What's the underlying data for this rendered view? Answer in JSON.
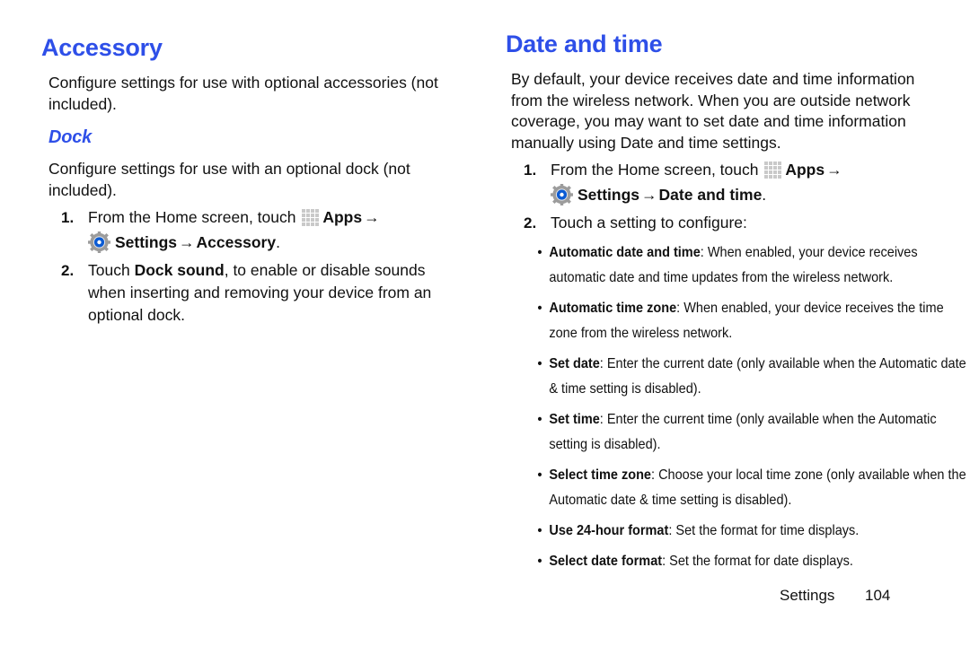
{
  "document": {
    "footer": {
      "section_label": "Settings",
      "page_number": "104"
    },
    "accent_color": "#2E4FE8",
    "text_color": "#111111"
  },
  "left_column": {
    "title": "Accessory",
    "intro": "Configure settings for use with optional accessories (not included).",
    "subsection": {
      "title": "Dock",
      "intro": "Configure settings for use with an optional dock (not included).",
      "steps": [
        {
          "number": "1.",
          "line1_prefix": "From the Home screen, touch ",
          "apps_label": "Apps",
          "arrow": "→",
          "settings_label": "Settings",
          "arrow2": "→",
          "destination_label": "Accessory",
          "period": "."
        },
        {
          "number": "2.",
          "text_prefix": "Touch ",
          "bold_term": "Dock sound",
          "text_suffix": ", to enable or disable sounds when inserting and removing your device from an optional dock."
        }
      ]
    }
  },
  "right_column": {
    "title": "Date and time",
    "intro": "By default, your device receives date and time information from the wireless network. When you are outside network coverage, you may want to set date and time information manually using Date and time settings.",
    "steps": [
      {
        "number": "1.",
        "line1_prefix": "From the Home screen, touch ",
        "apps_label": "Apps",
        "arrow": "→",
        "settings_label": "Settings",
        "arrow2": "→",
        "destination_label": "Date and time",
        "period": "."
      },
      {
        "number": "2.",
        "text": "Touch a setting to configure:"
      }
    ],
    "bullets": [
      {
        "bullet": "•",
        "term": "Automatic date and time",
        "description": ": When enabled, your device receives automatic date and time updates from the wireless network."
      },
      {
        "bullet": "•",
        "term": "Automatic time zone",
        "description": ": When enabled, your device receives the time zone from the wireless network."
      },
      {
        "bullet": "•",
        "term": "Set date",
        "description": ": Enter the current date (only available when the Automatic date & time setting is disabled)."
      },
      {
        "bullet": "•",
        "term": "Set time",
        "description": ": Enter the current time (only available when the Automatic setting is disabled)."
      },
      {
        "bullet": "•",
        "term": "Select time zone",
        "description": ": Choose your local time zone (only available when the Automatic date & time setting is disabled)."
      },
      {
        "bullet": "•",
        "term": "Use 24-hour format",
        "description": ": Set the format for time displays."
      },
      {
        "bullet": "•",
        "term": "Select date format",
        "description": ": Set the format for date displays."
      }
    ]
  },
  "icons": {
    "apps_grid": "apps-grid-icon",
    "settings_gear": "settings-gear-icon",
    "gear_body_color": "#9C9C9C",
    "gear_ring_color": "#0B5BD3",
    "apps_cell_color": "#C9C9C9"
  }
}
